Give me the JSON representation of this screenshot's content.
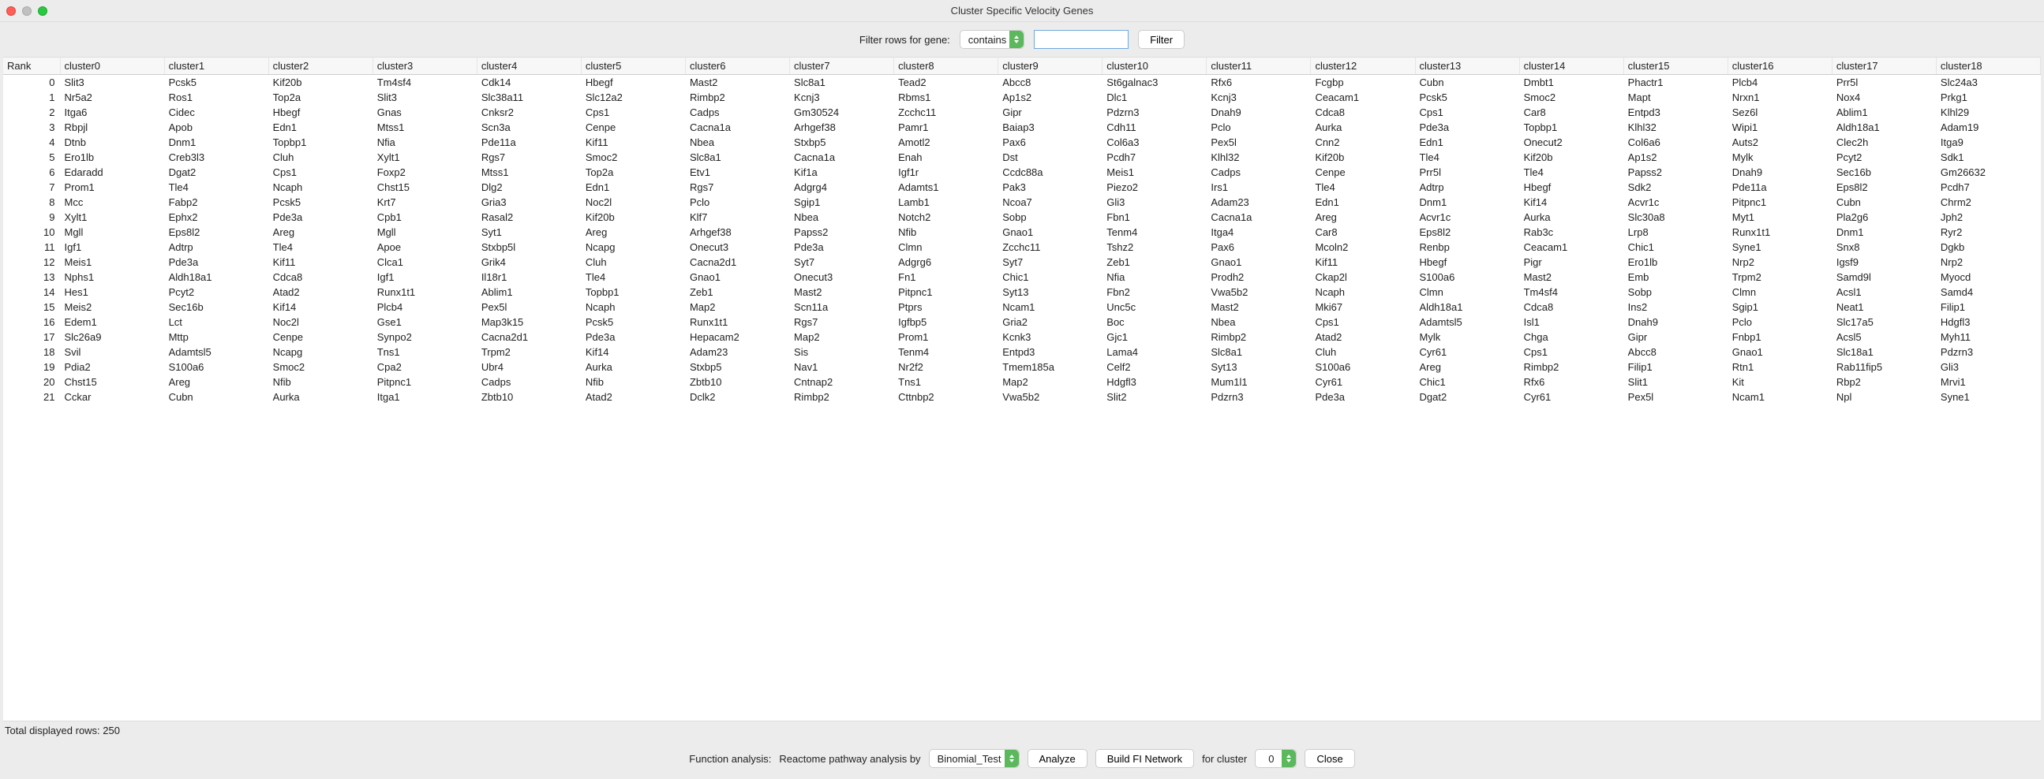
{
  "title": "Cluster Specific Velocity Genes",
  "filter": {
    "label": "Filter rows for gene:",
    "mode": "contains",
    "value": "",
    "button": "Filter"
  },
  "columns": [
    "Rank",
    "cluster0",
    "cluster1",
    "cluster2",
    "cluster3",
    "cluster4",
    "cluster5",
    "cluster6",
    "cluster7",
    "cluster8",
    "cluster9",
    "cluster10",
    "cluster11",
    "cluster12",
    "cluster13",
    "cluster14",
    "cluster15",
    "cluster16",
    "cluster17",
    "cluster18"
  ],
  "rows": [
    {
      "rank": 0,
      "cells": [
        "Slit3",
        "Pcsk5",
        "Kif20b",
        "Tm4sf4",
        "Cdk14",
        "Hbegf",
        "Mast2",
        "Slc8a1",
        "Tead2",
        "Abcc8",
        "St6galnac3",
        "Rfx6",
        "Fcgbp",
        "Cubn",
        "Dmbt1",
        "Phactr1",
        "Plcb4",
        "Prr5l",
        "Slc24a3"
      ]
    },
    {
      "rank": 1,
      "cells": [
        "Nr5a2",
        "Ros1",
        "Top2a",
        "Slit3",
        "Slc38a11",
        "Slc12a2",
        "Rimbp2",
        "Kcnj3",
        "Rbms1",
        "Ap1s2",
        "Dlc1",
        "Kcnj3",
        "Ceacam1",
        "Pcsk5",
        "Smoc2",
        "Mapt",
        "Nrxn1",
        "Nox4",
        "Prkg1"
      ]
    },
    {
      "rank": 2,
      "cells": [
        "Itga6",
        "Cidec",
        "Hbegf",
        "Gnas",
        "Cnksr2",
        "Cps1",
        "Cadps",
        "Gm30524",
        "Zcchc11",
        "Gipr",
        "Pdzrn3",
        "Dnah9",
        "Cdca8",
        "Cps1",
        "Car8",
        "Entpd3",
        "Sez6l",
        "Ablim1",
        "Klhl29"
      ]
    },
    {
      "rank": 3,
      "cells": [
        "Rbpjl",
        "Apob",
        "Edn1",
        "Mtss1",
        "Scn3a",
        "Cenpe",
        "Cacna1a",
        "Arhgef38",
        "Pamr1",
        "Baiap3",
        "Cdh11",
        "Pclo",
        "Aurka",
        "Pde3a",
        "Topbp1",
        "Klhl32",
        "Wipi1",
        "Aldh18a1",
        "Adam19"
      ]
    },
    {
      "rank": 4,
      "cells": [
        "Dtnb",
        "Dnm1",
        "Topbp1",
        "Nfia",
        "Pde11a",
        "Kif11",
        "Nbea",
        "Stxbp5",
        "Amotl2",
        "Pax6",
        "Col6a3",
        "Pex5l",
        "Cnn2",
        "Edn1",
        "Onecut2",
        "Col6a6",
        "Auts2",
        "Clec2h",
        "Itga9"
      ]
    },
    {
      "rank": 5,
      "cells": [
        "Ero1lb",
        "Creb3l3",
        "Cluh",
        "Xylt1",
        "Rgs7",
        "Smoc2",
        "Slc8a1",
        "Cacna1a",
        "Enah",
        "Dst",
        "Pcdh7",
        "Klhl32",
        "Kif20b",
        "Tle4",
        "Kif20b",
        "Ap1s2",
        "Mylk",
        "Pcyt2",
        "Sdk1"
      ]
    },
    {
      "rank": 6,
      "cells": [
        "Edaradd",
        "Dgat2",
        "Cps1",
        "Foxp2",
        "Mtss1",
        "Top2a",
        "Etv1",
        "Kif1a",
        "Igf1r",
        "Ccdc88a",
        "Meis1",
        "Cadps",
        "Cenpe",
        "Prr5l",
        "Tle4",
        "Papss2",
        "Dnah9",
        "Sec16b",
        "Gm26632"
      ]
    },
    {
      "rank": 7,
      "cells": [
        "Prom1",
        "Tle4",
        "Ncaph",
        "Chst15",
        "Dlg2",
        "Edn1",
        "Rgs7",
        "Adgrg4",
        "Adamts1",
        "Pak3",
        "Piezo2",
        "Irs1",
        "Tle4",
        "Adtrp",
        "Hbegf",
        "Sdk2",
        "Pde11a",
        "Eps8l2",
        "Pcdh7"
      ]
    },
    {
      "rank": 8,
      "cells": [
        "Mcc",
        "Fabp2",
        "Pcsk5",
        "Krt7",
        "Gria3",
        "Noc2l",
        "Pclo",
        "Sgip1",
        "Lamb1",
        "Ncoa7",
        "Gli3",
        "Adam23",
        "Edn1",
        "Dnm1",
        "Kif14",
        "Acvr1c",
        "Pitpnc1",
        "Cubn",
        "Chrm2"
      ]
    },
    {
      "rank": 9,
      "cells": [
        "Xylt1",
        "Ephx2",
        "Pde3a",
        "Cpb1",
        "Rasal2",
        "Kif20b",
        "Klf7",
        "Nbea",
        "Notch2",
        "Sobp",
        "Fbn1",
        "Cacna1a",
        "Areg",
        "Acvr1c",
        "Aurka",
        "Slc30a8",
        "Myt1",
        "Pla2g6",
        "Jph2"
      ]
    },
    {
      "rank": 10,
      "cells": [
        "Mgll",
        "Eps8l2",
        "Areg",
        "Mgll",
        "Syt1",
        "Areg",
        "Arhgef38",
        "Papss2",
        "Nfib",
        "Gnao1",
        "Tenm4",
        "Itga4",
        "Car8",
        "Eps8l2",
        "Rab3c",
        "Lrp8",
        "Runx1t1",
        "Dnm1",
        "Ryr2"
      ]
    },
    {
      "rank": 11,
      "cells": [
        "Igf1",
        "Adtrp",
        "Tle4",
        "Apoe",
        "Stxbp5l",
        "Ncapg",
        "Onecut3",
        "Pde3a",
        "Clmn",
        "Zcchc11",
        "Tshz2",
        "Pax6",
        "Mcoln2",
        "Renbp",
        "Ceacam1",
        "Chic1",
        "Syne1",
        "Snx8",
        "Dgkb"
      ]
    },
    {
      "rank": 12,
      "cells": [
        "Meis1",
        "Pde3a",
        "Kif11",
        "Clca1",
        "Grik4",
        "Cluh",
        "Cacna2d1",
        "Syt7",
        "Adgrg6",
        "Syt7",
        "Zeb1",
        "Gnao1",
        "Kif11",
        "Hbegf",
        "Pigr",
        "Ero1lb",
        "Nrp2",
        "Igsf9",
        "Nrp2"
      ]
    },
    {
      "rank": 13,
      "cells": [
        "Nphs1",
        "Aldh18a1",
        "Cdca8",
        "Igf1",
        "Il18r1",
        "Tle4",
        "Gnao1",
        "Onecut3",
        "Fn1",
        "Chic1",
        "Nfia",
        "Prodh2",
        "Ckap2l",
        "S100a6",
        "Mast2",
        "Emb",
        "Trpm2",
        "Samd9l",
        "Myocd"
      ]
    },
    {
      "rank": 14,
      "cells": [
        "Hes1",
        "Pcyt2",
        "Atad2",
        "Runx1t1",
        "Ablim1",
        "Topbp1",
        "Zeb1",
        "Mast2",
        "Pitpnc1",
        "Syt13",
        "Fbn2",
        "Vwa5b2",
        "Ncaph",
        "Clmn",
        "Tm4sf4",
        "Sobp",
        "Clmn",
        "Acsl1",
        "Samd4"
      ]
    },
    {
      "rank": 15,
      "cells": [
        "Meis2",
        "Sec16b",
        "Kif14",
        "Plcb4",
        "Pex5l",
        "Ncaph",
        "Map2",
        "Scn11a",
        "Ptprs",
        "Ncam1",
        "Unc5c",
        "Mast2",
        "Mki67",
        "Aldh18a1",
        "Cdca8",
        "Ins2",
        "Sgip1",
        "Neat1",
        "Filip1"
      ]
    },
    {
      "rank": 16,
      "cells": [
        "Edem1",
        "Lct",
        "Noc2l",
        "Gse1",
        "Map3k15",
        "Pcsk5",
        "Runx1t1",
        "Rgs7",
        "Igfbp5",
        "Gria2",
        "Boc",
        "Nbea",
        "Cps1",
        "Adamtsl5",
        "Isl1",
        "Dnah9",
        "Pclo",
        "Slc17a5",
        "Hdgfl3"
      ]
    },
    {
      "rank": 17,
      "cells": [
        "Slc26a9",
        "Mttp",
        "Cenpe",
        "Synpo2",
        "Cacna2d1",
        "Pde3a",
        "Hepacam2",
        "Map2",
        "Prom1",
        "Kcnk3",
        "Gjc1",
        "Rimbp2",
        "Atad2",
        "Mylk",
        "Chga",
        "Gipr",
        "Fnbp1",
        "Acsl5",
        "Myh11"
      ]
    },
    {
      "rank": 18,
      "cells": [
        "Svil",
        "Adamtsl5",
        "Ncapg",
        "Tns1",
        "Trpm2",
        "Kif14",
        "Adam23",
        "Sis",
        "Tenm4",
        "Entpd3",
        "Lama4",
        "Slc8a1",
        "Cluh",
        "Cyr61",
        "Cps1",
        "Abcc8",
        "Gnao1",
        "Slc18a1",
        "Pdzrn3"
      ]
    },
    {
      "rank": 19,
      "cells": [
        "Pdia2",
        "S100a6",
        "Smoc2",
        "Cpa2",
        "Ubr4",
        "Aurka",
        "Stxbp5",
        "Nav1",
        "Nr2f2",
        "Tmem185a",
        "Celf2",
        "Syt13",
        "S100a6",
        "Areg",
        "Rimbp2",
        "Filip1",
        "Rtn1",
        "Rab11fip5",
        "Gli3"
      ]
    },
    {
      "rank": 20,
      "cells": [
        "Chst15",
        "Areg",
        "Nfib",
        "Pitpnc1",
        "Cadps",
        "Nfib",
        "Zbtb10",
        "Cntnap2",
        "Tns1",
        "Map2",
        "Hdgfl3",
        "Mum1l1",
        "Cyr61",
        "Chic1",
        "Rfx6",
        "Slit1",
        "Kit",
        "Rbp2",
        "Mrvi1"
      ]
    },
    {
      "rank": 21,
      "cells": [
        "Cckar",
        "Cubn",
        "Aurka",
        "Itga1",
        "Zbtb10",
        "Atad2",
        "Dclk2",
        "Rimbp2",
        "Cttnbp2",
        "Vwa5b2",
        "Slit2",
        "Pdzrn3",
        "Pde3a",
        "Dgat2",
        "Cyr61",
        "Pex5l",
        "Ncam1",
        "Npl",
        "Syne1"
      ]
    }
  ],
  "status": "Total displayed rows: 250",
  "bottom": {
    "func_label": "Function analysis:",
    "reactome_label": "Reactome pathway analysis by",
    "test": "Binomial_Test",
    "analyze": "Analyze",
    "build": "Build FI Network",
    "for_cluster": "for cluster",
    "cluster_value": "0",
    "close": "Close"
  }
}
